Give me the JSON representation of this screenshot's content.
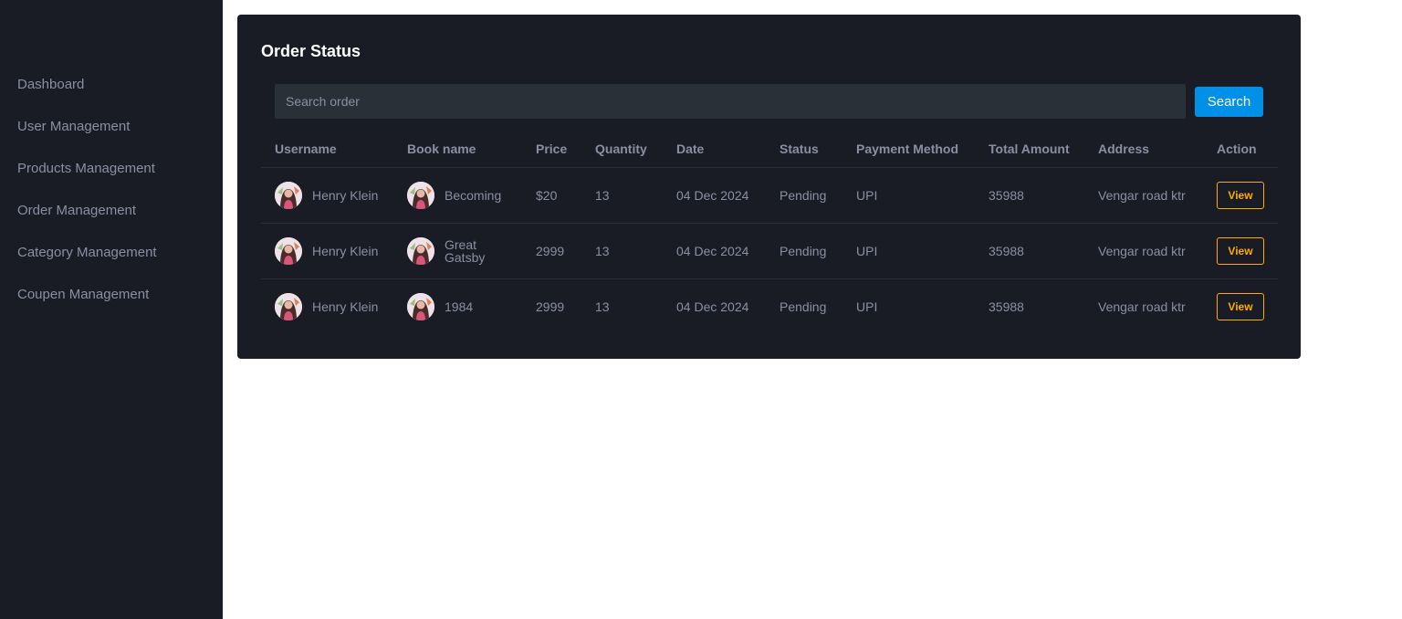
{
  "sidebar": {
    "items": [
      {
        "label": "Dashboard"
      },
      {
        "label": "User Management"
      },
      {
        "label": "Products Management"
      },
      {
        "label": "Order Management"
      },
      {
        "label": "Category Management"
      },
      {
        "label": "Coupen Management"
      }
    ]
  },
  "main": {
    "title": "Order Status",
    "search": {
      "placeholder": "Search order",
      "value": "",
      "button_label": "Search"
    },
    "table": {
      "columns": [
        "Username",
        "Book name",
        "Price",
        "Quantity",
        "Date",
        "Status",
        "Payment Method",
        "Total Amount",
        "Address",
        "Action"
      ],
      "rows": [
        {
          "username": "Henry Klein",
          "book": "Becoming",
          "price": "$20",
          "quantity": "13",
          "date": "04 Dec 2024",
          "status": "Pending",
          "payment": "UPI",
          "total": "35988",
          "address": "Vengar road ktr",
          "action": "View"
        },
        {
          "username": "Henry Klein",
          "book": "Great Gatsby",
          "price": "2999",
          "quantity": "13",
          "date": "04 Dec 2024",
          "status": "Pending",
          "payment": "UPI",
          "total": "35988",
          "address": "Vengar road ktr",
          "action": "View"
        },
        {
          "username": "Henry Klein",
          "book": "1984",
          "price": "2999",
          "quantity": "13",
          "date": "04 Dec 2024",
          "status": "Pending",
          "payment": "UPI",
          "total": "35988",
          "address": "Vengar road ktr",
          "action": "View"
        }
      ]
    }
  },
  "colors": {
    "sidebar_bg": "#191c24",
    "card_bg": "#191c24",
    "muted_text": "#8a8fa3",
    "search_bg": "#2a3038",
    "primary": "#0090e7",
    "warning": "#ffab00"
  },
  "icons": {
    "avatar": "user-avatar-icon",
    "book_thumb": "book-thumbnail-icon"
  }
}
